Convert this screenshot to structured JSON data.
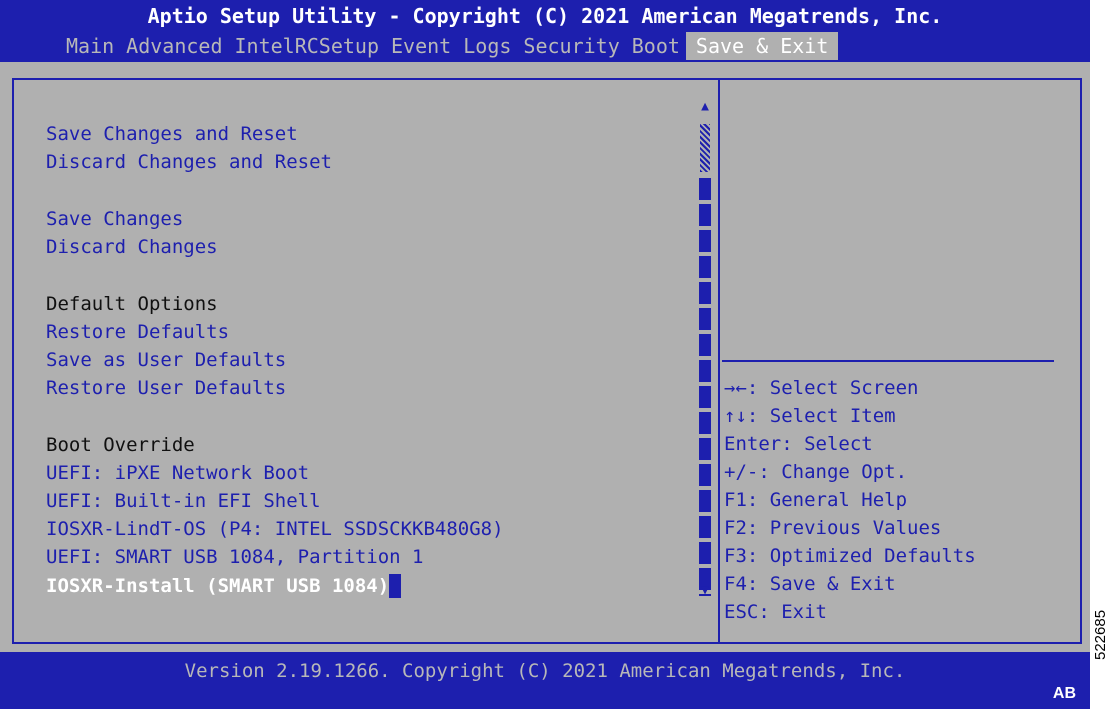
{
  "window": {
    "title": "Aptio Setup Utility - Copyright (C) 2021 American Megatrends, Inc."
  },
  "tabs": [
    {
      "label": "Main",
      "active": false
    },
    {
      "label": "Advanced",
      "active": false
    },
    {
      "label": "IntelRCSetup",
      "active": false
    },
    {
      "label": "Event Logs",
      "active": false
    },
    {
      "label": "Security",
      "active": false
    },
    {
      "label": "Boot",
      "active": false
    },
    {
      "label": "Save & Exit",
      "active": true
    }
  ],
  "menu": {
    "save_changes_reset": "Save Changes and Reset",
    "discard_changes_reset": "Discard Changes and Reset",
    "save_changes": "Save Changes",
    "discard_changes": "Discard Changes",
    "default_options_header": "Default Options",
    "restore_defaults": "Restore Defaults",
    "save_user_defaults": "Save as User Defaults",
    "restore_user_defaults": "Restore User Defaults",
    "boot_override_header": "Boot Override",
    "boot_ipxe": "UEFI: iPXE Network Boot",
    "boot_efi_shell": "UEFI: Built-in EFI Shell",
    "boot_iosxr_lindt": "IOSXR-LindT-OS (P4: INTEL SSDSCKKB480G8)",
    "boot_smart_usb": "UEFI: SMART USB 1084, Partition 1",
    "boot_iosxr_install": "IOSXR-Install (SMART USB 1084)"
  },
  "help": [
    "→←: Select Screen",
    "↑↓: Select Item",
    "Enter: Select",
    "+/-: Change Opt.",
    "F1: General Help",
    "F2: Previous Values",
    "F3: Optimized Defaults",
    "F4: Save & Exit",
    "ESC: Exit"
  ],
  "footer": {
    "version": "Version 2.19.1266. Copyright (C) 2021 American Megatrends, Inc.",
    "badge": "AB"
  },
  "side_id": "522685",
  "icons": {
    "scroll_up": "▲",
    "scroll_down": "▼"
  },
  "colors": {
    "accent_blue": "#1d1fae",
    "panel_gray": "#b0b0b0",
    "selected_text": "#ffffff"
  }
}
